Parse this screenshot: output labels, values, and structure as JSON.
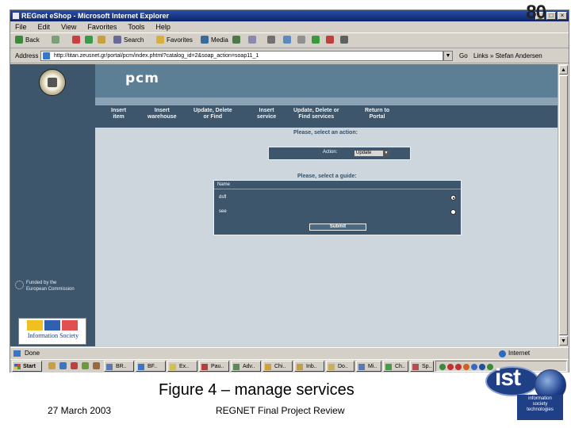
{
  "slide": {
    "number": "80",
    "caption": "Figure 4 – manage services",
    "date": "27 March 2003",
    "footer_title": "REGNET Final Project Review"
  },
  "browser": {
    "title": "REGnet eShop - Microsoft Internet Explorer",
    "menu": [
      "File",
      "Edit",
      "View",
      "Favorites",
      "Tools",
      "Help"
    ],
    "toolbar": {
      "back": "Back",
      "search": "Search",
      "favorites": "Favorites",
      "media": "Media"
    },
    "address": {
      "label": "Address",
      "url": "http://titan.zeusnet.gr/portal/pcm/index.phtml?catalog_id=2&soap_action=soap11_1",
      "go": "Go",
      "links": "Links",
      "links_extra": "Stefan Andersen"
    },
    "status": {
      "text": "Done",
      "zone": "Internet"
    }
  },
  "page": {
    "app_title": "pcm",
    "nav": [
      "Insert\nitem",
      "Insert\nwarehouse",
      "Update, Delete\nor Find",
      "Insert\nservice",
      "Update, Delete or\nFind services",
      "Return to\nPortal"
    ],
    "select_action_label": "Please, select an action:",
    "action_label": "Action:",
    "action_value": "Update",
    "select_a_guide_label": "Please, select a guide:",
    "table_header": "Name",
    "services": [
      {
        "name": "dsfl",
        "selected": true
      },
      {
        "name": "see",
        "selected": false
      }
    ],
    "submit": "Submit",
    "funded_by": "Funded by the\nEuropean Commission",
    "ist_society": "Information Society"
  },
  "taskbar": {
    "start": "Start",
    "tasks": [
      "BR..",
      "BF..",
      "Ex..",
      "Pau..",
      "Adv..",
      "Chi..",
      "Inb..",
      "Do..",
      "Mi..",
      "Ch..",
      "Sp.."
    ]
  },
  "ist_logo": {
    "word": "ist",
    "line1": "information",
    "line2": "society",
    "line3": "technologies"
  },
  "colors": {
    "sidebar": "#3d566b",
    "header": "#5d7f96",
    "page_bg": "#ced6dd",
    "titlebar": "#0a246a"
  }
}
